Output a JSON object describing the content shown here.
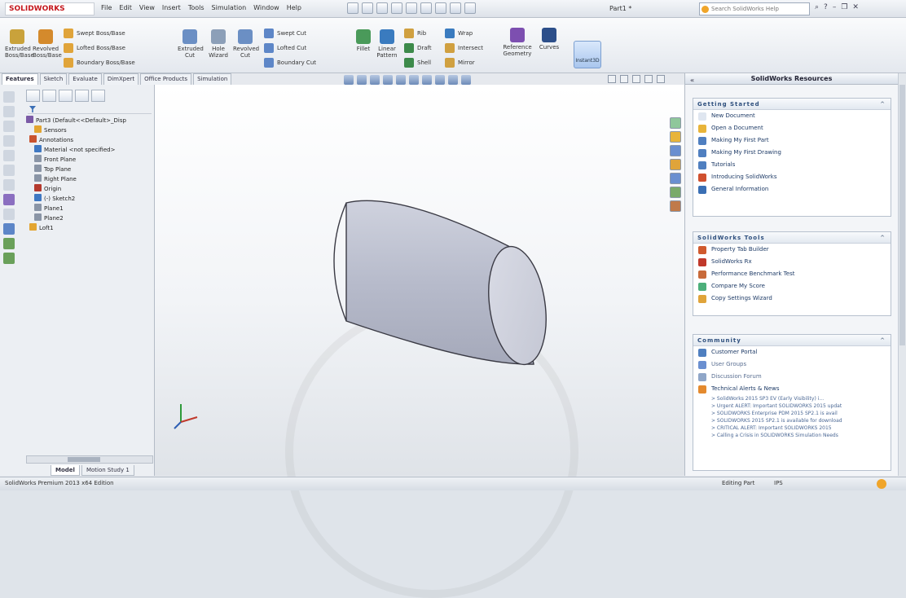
{
  "app": {
    "logo_text": "SOLIDWORKS",
    "document_title": "Part1 *",
    "search_placeholder": "Search SolidWorks Help"
  },
  "menu": [
    "File",
    "Edit",
    "View",
    "Insert",
    "Tools",
    "Simulation",
    "Window",
    "Help"
  ],
  "toolbar": {
    "extruded_boss": "Extruded Boss/Base",
    "revolved_boss": "Revolved Boss/Base",
    "swept_boss": "Swept Boss/Base",
    "lofted_boss": "Lofted Boss/Base",
    "boundary_boss": "Boundary Boss/Base",
    "extruded_cut": "Extruded Cut",
    "hole_wizard": "Hole Wizard",
    "revolved_cut": "Revolved Cut",
    "swept_cut": "Swept Cut",
    "lofted_cut": "Lofted Cut",
    "boundary_cut": "Boundary Cut",
    "fillet": "Fillet",
    "linear_pattern": "Linear Pattern",
    "rib": "Rib",
    "draft": "Draft",
    "shell": "Shell",
    "wrap": "Wrap",
    "intersect": "Intersect",
    "mirror": "Mirror",
    "reference_geometry": "Reference Geometry",
    "curves": "Curves",
    "instant3d": "Instant3D"
  },
  "tabs": [
    "Features",
    "Sketch",
    "Evaluate",
    "DimXpert",
    "Office Products",
    "Simulation"
  ],
  "feature_tree": [
    {
      "label": "Part3 (Default<<Default>_Disp",
      "icon": "part-icon",
      "color": "#7b5aa6"
    },
    {
      "label": "Sensors",
      "icon": "sensors-icon",
      "color": "#e3a531"
    },
    {
      "label": "Annotations",
      "icon": "annotations-icon",
      "color": "#c9532f"
    },
    {
      "label": "Material <not specified>",
      "icon": "material-icon",
      "color": "#3f78c2"
    },
    {
      "label": "Front Plane",
      "icon": "plane-icon",
      "color": "#8a95a6"
    },
    {
      "label": "Top Plane",
      "icon": "plane-icon",
      "color": "#8a95a6"
    },
    {
      "label": "Right Plane",
      "icon": "plane-icon",
      "color": "#8a95a6"
    },
    {
      "label": "Origin",
      "icon": "origin-icon",
      "color": "#b53a2e"
    },
    {
      "label": "(-) Sketch2",
      "icon": "sketch-icon",
      "color": "#3f78c2"
    },
    {
      "label": "Plane1",
      "icon": "plane-icon",
      "color": "#8a95a6"
    },
    {
      "label": "Plane2",
      "icon": "plane-icon",
      "color": "#8a95a6"
    },
    {
      "label": "Loft1",
      "icon": "loft-icon",
      "color": "#e3a531"
    }
  ],
  "bottom_tabs": [
    "Model",
    "Motion Study 1"
  ],
  "task_pane": {
    "title": "SolidWorks Resources",
    "getting_started": {
      "header": "Getting Started",
      "items": [
        {
          "label": "New Document",
          "color": "#dfe6f0"
        },
        {
          "label": "Open a Document",
          "color": "#e8b43a"
        },
        {
          "label": "Making My First Part",
          "color": "#4f7fc0"
        },
        {
          "label": "Making My First Drawing",
          "color": "#4f7fc0"
        },
        {
          "label": "Tutorials",
          "color": "#4f7fc0"
        },
        {
          "label": "Introducing SolidWorks",
          "color": "#d0502f"
        },
        {
          "label": "General Information",
          "color": "#3a6fb4"
        }
      ]
    },
    "tools": {
      "header": "SolidWorks Tools",
      "items": [
        {
          "label": "Property Tab Builder",
          "color": "#d05a2e"
        },
        {
          "label": "SolidWorks Rx",
          "color": "#c0392b"
        },
        {
          "label": "Performance Benchmark Test",
          "color": "#c86a3a"
        },
        {
          "label": "Compare My Score",
          "color": "#4caf7a"
        },
        {
          "label": "Copy Settings Wizard",
          "color": "#e0a43a"
        }
      ]
    },
    "community": {
      "header": "Community",
      "items": [
        {
          "label": "Customer Portal",
          "color": "#4f7fc0"
        },
        {
          "label": "User Groups",
          "color": "#6a8fd0"
        },
        {
          "label": "Discussion Forum",
          "color": "#8fa6c8"
        },
        {
          "label": "Technical Alerts & News",
          "color": "#e48a2e"
        }
      ],
      "news": [
        "> SolidWorks 2015 SP3 EV (Early Visibility) i...",
        "> Urgent ALERT: Important SOLIDWORKS 2015 updat",
        "> SOLIDWORKS Enterprise PDM 2015 SP2.1 is avail",
        "> SOLIDWORKS 2015 SP2.1 is available for download",
        "> CRITICAL ALERT: Important SOLIDWORKS 2015",
        "> Calling a Crisis in SOLIDWORKS Simulation Needs"
      ]
    }
  },
  "status": {
    "edition": "SolidWorks Premium 2013 x64 Edition",
    "mode": "Editing Part",
    "units": "IPS"
  }
}
